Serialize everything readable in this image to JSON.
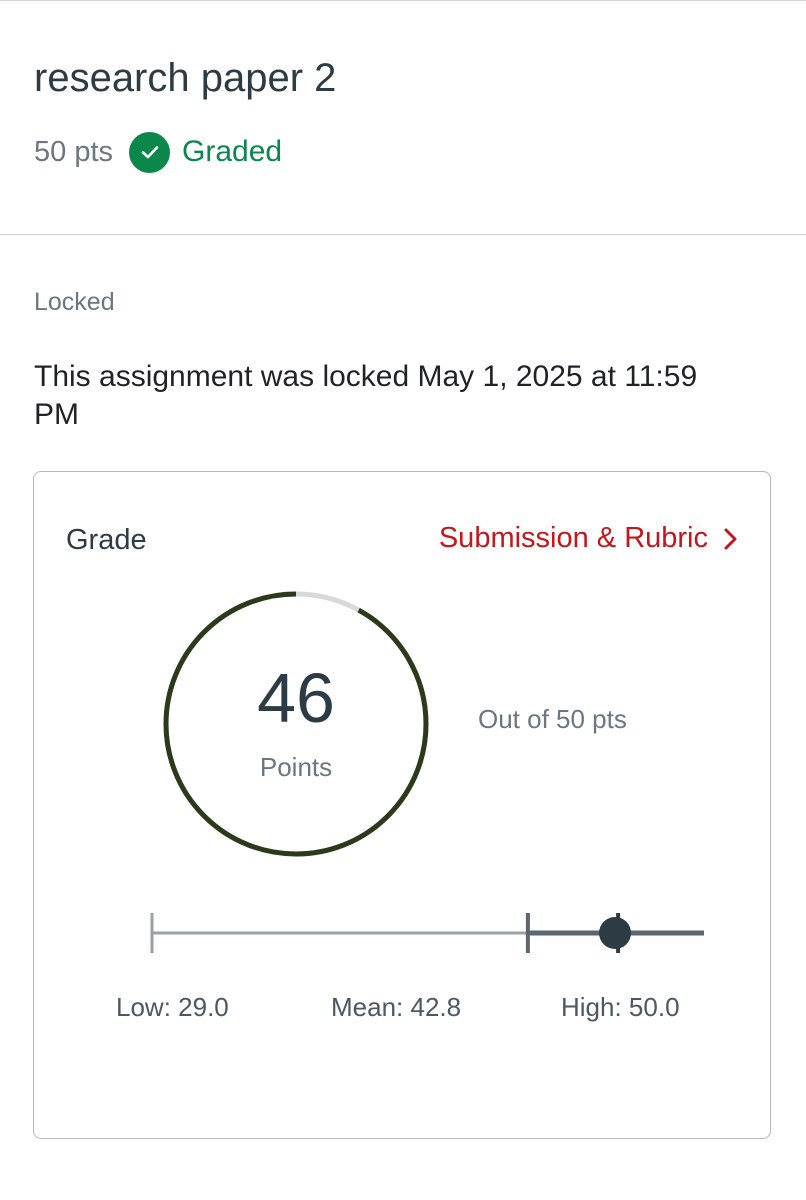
{
  "assignment": {
    "title": "research paper 2",
    "points": "50 pts",
    "status": "Graded",
    "status_color": "#0b874b",
    "status_icon": "checkmark-icon"
  },
  "lock": {
    "label": "Locked",
    "message": "This assignment was locked May 1, 2025 at 11:59 PM"
  },
  "grade": {
    "heading": "Grade",
    "link_label": "Submission & Rubric",
    "link_color": "#c4161c",
    "link_icon": "chevron-right-icon",
    "score": "46",
    "score_unit": "Points",
    "out_of": "Out of 50 pts",
    "score_fraction": 0.92,
    "ring_color": "#2b3a1a",
    "stats": {
      "low_label": "Low: 29.0",
      "mean_label": "Mean: 42.8",
      "high_label": "High: 50.0",
      "low": 29.0,
      "mean": 42.8,
      "high": 50.0,
      "score": 46
    }
  }
}
